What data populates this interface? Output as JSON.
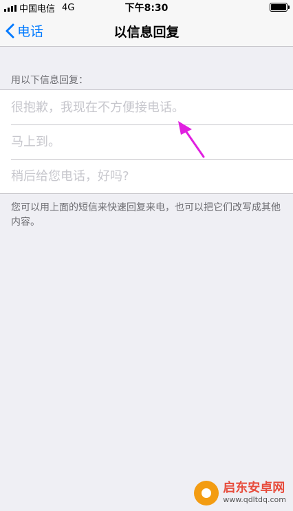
{
  "statusbar": {
    "carrier": "中国电信",
    "network": "4G",
    "time": "下午8:30"
  },
  "navbar": {
    "back_label": "电话",
    "title": "以信息回复"
  },
  "section": {
    "header": "用以下信息回复：",
    "replies": [
      {
        "placeholder": "很抱歉，我现在不方便接电话。",
        "value": ""
      },
      {
        "placeholder": "马上到。",
        "value": ""
      },
      {
        "placeholder": "稍后给您电话，好吗?",
        "value": ""
      }
    ],
    "footer": "您可以用上面的短信来快速回复来电，也可以把它们改写成其他内容。"
  },
  "annotation": {
    "arrow_color": "#e020e0"
  },
  "watermark": {
    "name": "启东安卓网",
    "url": "www.qdltdq.com"
  },
  "colors": {
    "accent": "#007aff",
    "background": "#efeff4",
    "bar": "#f7f7f7"
  }
}
